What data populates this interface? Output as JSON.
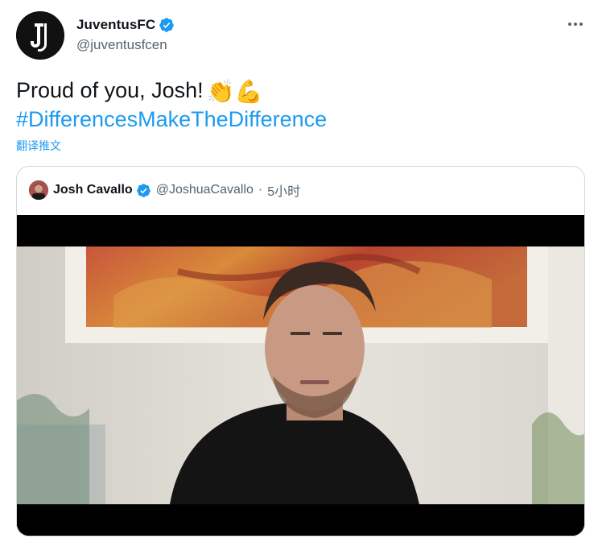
{
  "tweet": {
    "display_name": "JuventusFC",
    "handle": "@juventusfcen",
    "text": "Proud of you, Josh!",
    "emojis": "👏💪",
    "hashtag": "#DifferencesMakeTheDifference",
    "translate_label": "翻译推文"
  },
  "quoted_tweet": {
    "display_name": "Josh Cavallo",
    "handle": "@JoshuaCavallo",
    "separator": "·",
    "time": "5小时"
  },
  "icons": {
    "verified": "verified-badge-icon",
    "more": "more-options-icon",
    "avatar_logo": "juventus-j-logo"
  },
  "colors": {
    "link": "#1d9bf0",
    "secondary_text": "#536471",
    "primary_text": "#0f1419",
    "border": "#cfd9de"
  }
}
